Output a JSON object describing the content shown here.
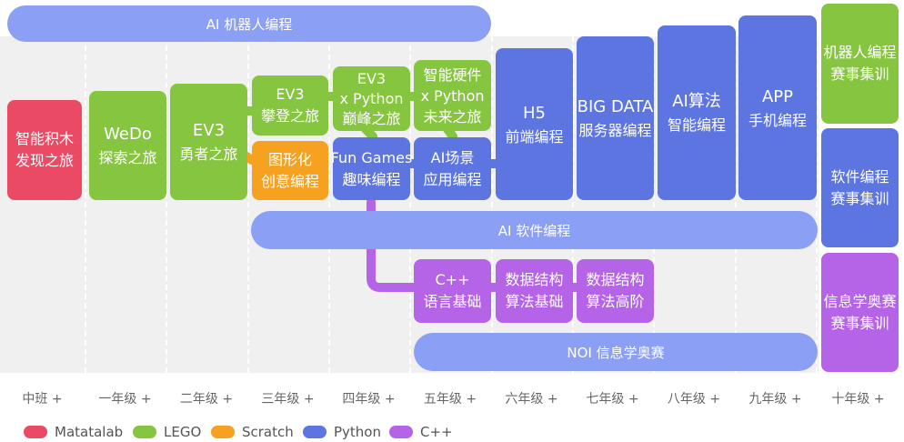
{
  "banners": {
    "robot": "AI 机器人编程",
    "software": "AI 软件编程",
    "noi": "NOI 信息学奥赛"
  },
  "courses": {
    "matatalab": [
      "智能积木",
      "发现之旅"
    ],
    "wedo": [
      "WeDo",
      "探索之旅"
    ],
    "ev3_brave": [
      "EV3",
      "勇者之旅"
    ],
    "ev3_climb": [
      "EV3",
      "攀登之旅"
    ],
    "graphical": [
      "图形化",
      "创意编程"
    ],
    "ev3_python": [
      "EV3",
      "x Python",
      "巅峰之旅"
    ],
    "fun_games": [
      "Fun Games",
      "趣味编程"
    ],
    "hardware_python": [
      "智能硬件",
      "x Python",
      "未来之旅"
    ],
    "ai_scene": [
      "AI场景",
      "应用编程"
    ],
    "h5": [
      "H5",
      "前端编程"
    ],
    "bigdata": [
      "BIG DATA",
      "服务器编程"
    ],
    "ai_algo": [
      "AI算法",
      "智能编程"
    ],
    "app": [
      "APP",
      "手机编程"
    ],
    "cpp_basic": [
      "C++",
      "语言基础"
    ],
    "ds_basic": [
      "数据结构",
      "算法基础"
    ],
    "ds_adv": [
      "数据结构",
      "算法高阶"
    ]
  },
  "competitions": {
    "robot": [
      "机器人编程",
      "赛事集训"
    ],
    "software": [
      "软件编程",
      "赛事集训"
    ],
    "informatics": [
      "信息学奥赛",
      "赛事集训"
    ]
  },
  "grades": [
    "中班 +",
    "一年级 +",
    "二年级 +",
    "三年级 +",
    "四年级 +",
    "五年级 +",
    "六年级 +",
    "七年级 +",
    "八年级 +",
    "九年级 +",
    "十年级 +"
  ],
  "legend": [
    {
      "label": "Matatalab",
      "color": "#ea4a64"
    },
    {
      "label": "LEGO",
      "color": "#86c53f"
    },
    {
      "label": "Scratch",
      "color": "#f7a121"
    },
    {
      "label": "Python",
      "color": "#5c75e0"
    },
    {
      "label": "C++",
      "color": "#b564e8"
    }
  ],
  "colors": {
    "matatalab": "#ea4a64",
    "lego": "#86c53f",
    "scratch": "#f7a121",
    "python": "#5c75e0",
    "cpp": "#b564e8",
    "banner": "#8b9ff5"
  }
}
